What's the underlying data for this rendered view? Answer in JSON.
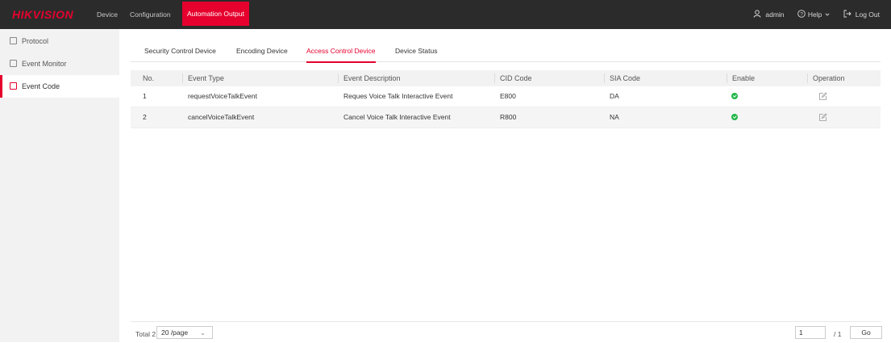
{
  "brand": {
    "logo_text": "HIKVISION",
    "accent_color": "#e5002d"
  },
  "top_nav": [
    {
      "label": "Device"
    },
    {
      "label": "Configuration"
    },
    {
      "label": "Automation Output"
    }
  ],
  "user_menu": {
    "username": "admin",
    "help_label": "Help",
    "logout_label": "Log Out"
  },
  "sidebar": {
    "items": [
      {
        "label": "Protocol",
        "icon": "protocol-icon"
      },
      {
        "label": "Event Monitor",
        "icon": "monitor-icon"
      },
      {
        "label": "Event Code",
        "icon": "event-code-icon",
        "active": true
      }
    ]
  },
  "tabs": [
    {
      "label": "Security Control Device"
    },
    {
      "label": "Encoding Device"
    },
    {
      "label": "Access Control Device",
      "active": true
    },
    {
      "label": "Device Status"
    }
  ],
  "table": {
    "columns": [
      "No.",
      "Event Type",
      "Event Description",
      "CID Code",
      "SIA Code",
      "Enable",
      "Operation"
    ],
    "rows": [
      {
        "no": "1",
        "event_type": "requestVoiceTalkEvent",
        "description": "Reques Voice Talk Interactive Event",
        "cid": "E800",
        "sia": "DA",
        "enabled": true
      },
      {
        "no": "2",
        "event_type": "cancelVoiceTalkEvent",
        "description": "Cancel Voice Talk Interactive Event",
        "cid": "R800",
        "sia": "NA",
        "enabled": true
      }
    ]
  },
  "pagination": {
    "total_label": "Total 2",
    "page_size": "20 /page",
    "current_page": "1",
    "total_pages": "/ 1",
    "go_label": "Go"
  }
}
